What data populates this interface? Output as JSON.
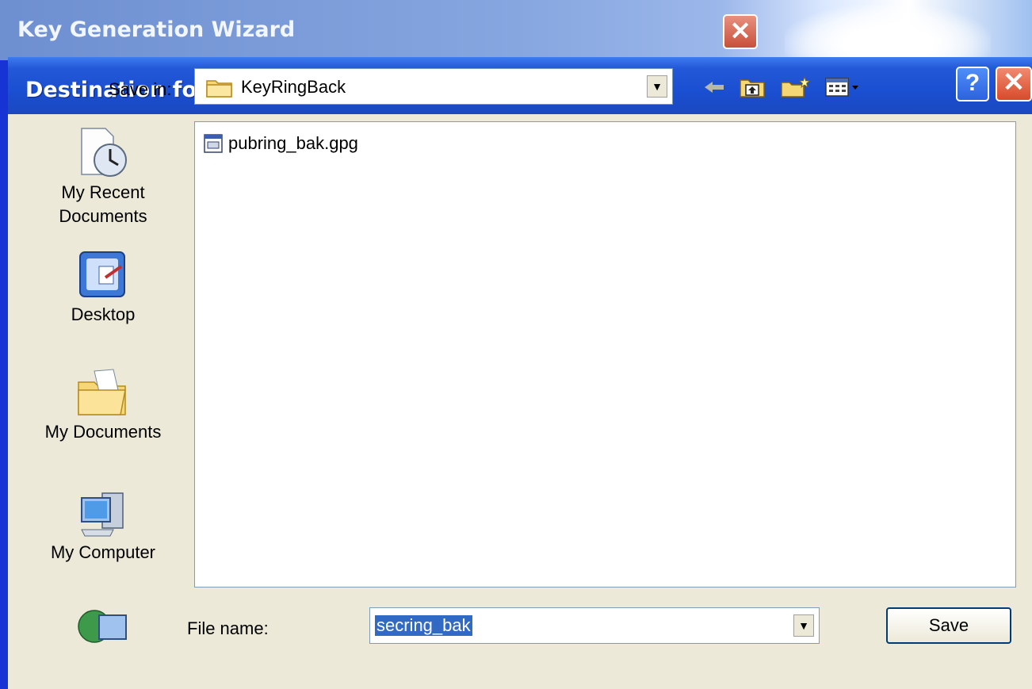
{
  "wizard": {
    "title": "Key Generation Wizard",
    "close_glyph": "✕"
  },
  "dialog": {
    "title": "Destination for Secret Keyring",
    "help_glyph": "?",
    "close_glyph": "✕"
  },
  "save_in": {
    "label": "Save in:",
    "value": "KeyRingBack",
    "arrow": "▼"
  },
  "toolbar": {
    "icons": [
      "back-arrow-icon",
      "up-one-level-icon",
      "new-folder-icon",
      "views-menu-icon"
    ]
  },
  "places": [
    {
      "label": "My Recent Documents",
      "icon": "recent-documents-icon"
    },
    {
      "label": "Desktop",
      "icon": "desktop-icon"
    },
    {
      "label": "My Documents",
      "icon": "my-documents-icon"
    },
    {
      "label": "My Computer",
      "icon": "my-computer-icon"
    },
    {
      "label": "",
      "icon": "network-places-icon"
    }
  ],
  "files": [
    {
      "name": "pubring_bak.gpg",
      "icon": "gpg-file-icon"
    }
  ],
  "file_name": {
    "label": "File name:",
    "value": "secring_bak",
    "arrow": "▼"
  },
  "buttons": {
    "save": "Save"
  },
  "colors": {
    "titlebar": "#1a4fd1",
    "dialog_bg": "#ece9d8",
    "selection": "#316ac5",
    "close_red": "#d84a2a"
  }
}
